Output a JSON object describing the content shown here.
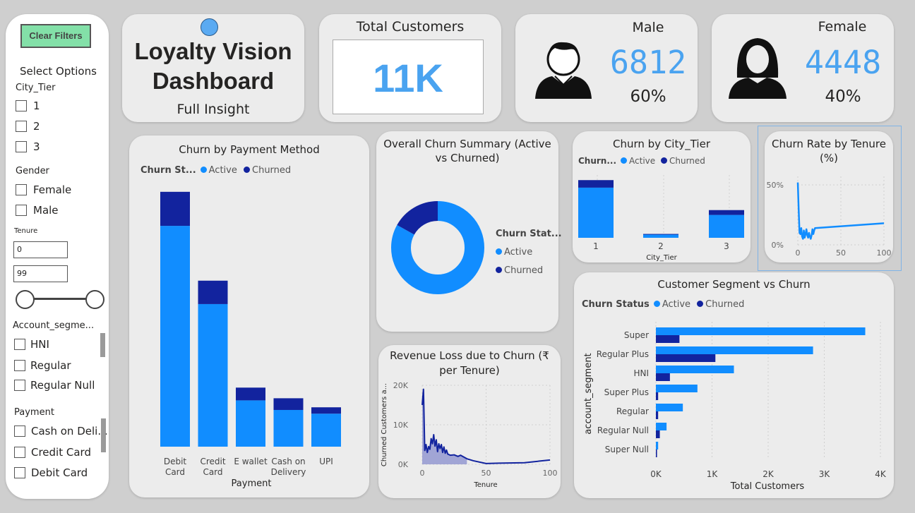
{
  "colors": {
    "active": "#118DFF",
    "churned": "#12239E",
    "kpi": "#4aa3f0",
    "clear_btn": "#83e0a8"
  },
  "filters": {
    "clear_label": "Clear Filters",
    "heading": "Select Options",
    "city_tier": {
      "label": "City_Tier",
      "options": [
        "1",
        "2",
        "3"
      ]
    },
    "gender": {
      "label": "Gender",
      "options": [
        "Female",
        "Male"
      ]
    },
    "tenure": {
      "label": "Tenure",
      "min": "0",
      "max": "99"
    },
    "account_segment": {
      "label": "Account_segme...",
      "options": [
        "HNI",
        "Regular",
        "Regular Null"
      ]
    },
    "payment": {
      "label": "Payment",
      "options": [
        "Cash on Deli...",
        "Credit Card",
        "Debit Card"
      ]
    }
  },
  "header": {
    "title_line1": "Loyalty Vision",
    "title_line2": "Dashboard",
    "subtitle": "Full Insight"
  },
  "kpi": {
    "total_label": "Total Customers",
    "total_value": "11K",
    "male_label": "Male",
    "male_value": "6812",
    "male_pct": "60%",
    "female_label": "Female",
    "female_value": "4448",
    "female_pct": "40%"
  },
  "legend": {
    "active": "Active",
    "churned": "Churned",
    "churn_status_short": "Churn St...",
    "churn_status": "Churn Status",
    "churn_dots": "Churn...",
    "churn_stat": "Churn Stat..."
  },
  "chart_data": [
    {
      "id": "payment",
      "type": "bar",
      "stacked": true,
      "title": "Churn by Payment Method",
      "xlabel": "Payment",
      "categories": [
        "Debit Card",
        "Credit Card",
        "E wallet",
        "Cash on Delivery",
        "UPI"
      ],
      "category_lines": [
        [
          "Debit",
          "Card"
        ],
        [
          "Credit",
          "Card"
        ],
        [
          "E wallet"
        ],
        [
          "Cash on",
          "Delivery"
        ],
        [
          "UPI"
        ]
      ],
      "series": [
        {
          "name": "Active",
          "values": [
            4150,
            2680,
            870,
            690,
            620
          ]
        },
        {
          "name": "Churned",
          "values": [
            640,
            440,
            240,
            220,
            120
          ]
        }
      ],
      "ylim": [
        0,
        5000
      ]
    },
    {
      "id": "summary",
      "type": "pie",
      "donut": true,
      "title": "Overall Churn Summary (Active vs Churned)",
      "title_lines": [
        "Overall Churn Summary (Active",
        "vs Churned)"
      ],
      "categories": [
        "Active",
        "Churned"
      ],
      "values": [
        83,
        17
      ]
    },
    {
      "id": "city",
      "type": "bar",
      "stacked": true,
      "title": "Churn by City_Tier",
      "xlabel": "City_Tier",
      "categories": [
        "1",
        "2",
        "3"
      ],
      "series": [
        {
          "name": "Active",
          "values": [
            5990,
            380,
            2730
          ]
        },
        {
          "name": "Churned",
          "values": [
            900,
            80,
            580
          ]
        }
      ],
      "ylim": [
        0,
        7500
      ]
    },
    {
      "id": "tenure_rate",
      "type": "line",
      "title": "Churn Rate by Tenure (%)",
      "title_lines": [
        "Churn Rate by Tenure",
        "(%)"
      ],
      "x": [
        0,
        1,
        2,
        3,
        4,
        5,
        6,
        7,
        8,
        9,
        10,
        11,
        12,
        13,
        14,
        15,
        16,
        17,
        18,
        19,
        20,
        100
      ],
      "y": [
        52,
        30,
        10,
        9,
        14,
        7,
        5,
        12,
        6,
        9,
        13,
        8,
        6,
        10,
        7,
        5,
        8,
        13,
        9,
        12,
        14,
        18
      ],
      "xticks": [
        "0",
        "50",
        "100"
      ],
      "yticks": [
        "0%",
        "50%"
      ],
      "xlim": [
        0,
        100
      ],
      "ylim": [
        0,
        60
      ]
    },
    {
      "id": "segment",
      "type": "bar",
      "orientation": "horizontal",
      "title": "Customer Segment vs Churn",
      "xlabel": "Total Customers",
      "ylabel": "account_segment",
      "categories": [
        "Super",
        "Regular Plus",
        "HNI",
        "Super Plus",
        "Regular",
        "Regular Null",
        "Super Null"
      ],
      "series": [
        {
          "name": "Active",
          "values": [
            3730,
            2800,
            1390,
            740,
            480,
            190,
            40
          ]
        },
        {
          "name": "Churned",
          "values": [
            420,
            1060,
            250,
            40,
            40,
            70,
            20
          ]
        }
      ],
      "xticks": [
        "0K",
        "1K",
        "2K",
        "3K",
        "4K"
      ],
      "xlim": [
        0,
        4000
      ]
    },
    {
      "id": "revenue",
      "type": "area",
      "title": "Revenue Loss due to Churn (₹ per Tenure)",
      "title_lines": [
        "Revenue Loss due to Churn (₹",
        "per Tenure)"
      ],
      "xlabel": "Tenure",
      "ylabel": "Churned Customers a...",
      "x": [
        0,
        1,
        2,
        3,
        4,
        5,
        6,
        7,
        8,
        9,
        10,
        11,
        12,
        13,
        14,
        15,
        16,
        17,
        18,
        19,
        20,
        22,
        25,
        28,
        30,
        35,
        40,
        50,
        60,
        80,
        100
      ],
      "y": [
        15000,
        19000,
        3500,
        5000,
        3000,
        4500,
        3800,
        6500,
        5200,
        7500,
        4600,
        6200,
        3200,
        5200,
        4000,
        5000,
        3000,
        4400,
        2800,
        3600,
        2600,
        2300,
        2400,
        2000,
        2300,
        1400,
        900,
        200,
        300,
        400,
        1100
      ],
      "xticks": [
        "0",
        "50",
        "100"
      ],
      "yticks": [
        "0K",
        "10K",
        "20K"
      ],
      "xlim": [
        0,
        100
      ],
      "ylim": [
        0,
        20000
      ]
    }
  ]
}
